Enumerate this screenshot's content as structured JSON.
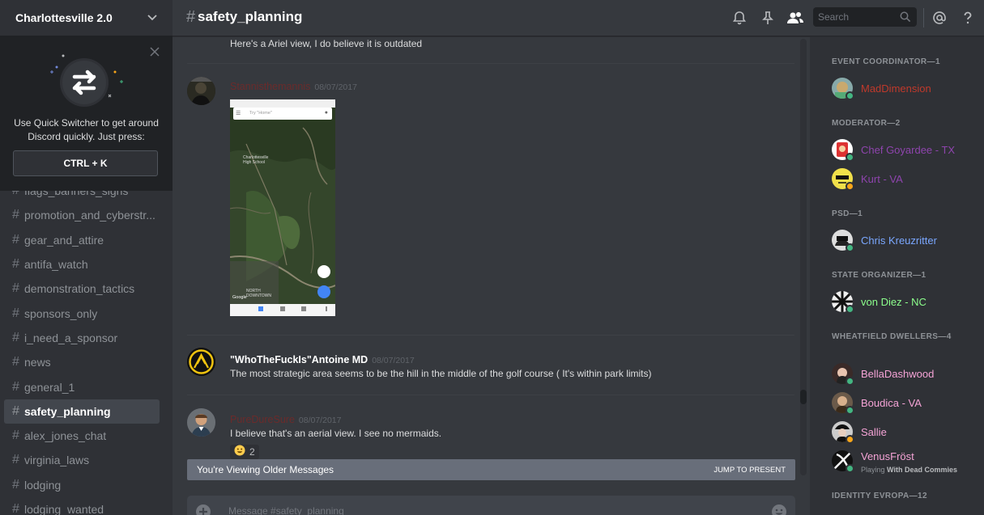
{
  "server": {
    "name": "Charlottesville 2.0"
  },
  "quick_switcher": {
    "text_line1": "Use Quick Switcher to get around",
    "text_line2": "Discord quickly. Just press:",
    "shortcut": "CTRL + K"
  },
  "channels": [
    {
      "name": "flags_banners_signs",
      "active": false
    },
    {
      "name": "promotion_and_cyberstr...",
      "active": false
    },
    {
      "name": "gear_and_attire",
      "active": false
    },
    {
      "name": "antifa_watch",
      "active": false
    },
    {
      "name": "demonstration_tactics",
      "active": false
    },
    {
      "name": "sponsors_only",
      "active": false
    },
    {
      "name": "i_need_a_sponsor",
      "active": false
    },
    {
      "name": "news",
      "active": false
    },
    {
      "name": "general_1",
      "active": false
    },
    {
      "name": "safety_planning",
      "active": true
    },
    {
      "name": "alex_jones_chat",
      "active": false
    },
    {
      "name": "virginia_laws",
      "active": false
    },
    {
      "name": "lodging",
      "active": false
    },
    {
      "name": "lodging_wanted",
      "active": false
    }
  ],
  "header": {
    "hash": "#",
    "channel": "safety_planning",
    "search_placeholder": "Search"
  },
  "messages": [
    {
      "author": "",
      "timestamp": "",
      "text": "Here's a Ariel view, I do believe it is outdated",
      "author_color": ""
    },
    {
      "author": "Stannisthemannis",
      "timestamp": "08/07/2017",
      "text": "",
      "author_color": "#6b2b2b",
      "attachment": {
        "search_placeholder": "Try \"Home\"",
        "map_label_1": "Charlottesville High School",
        "map_label_2": "NORTH DOWNTOWN",
        "google": "Google"
      }
    },
    {
      "author": "\"WhoTheFuckIs\"Antoine MD",
      "timestamp": "08/07/2017",
      "text": "The most strategic area seems to be the hill in the middle of the golf course ( It's within park limits)",
      "author_color": "#ffffff"
    },
    {
      "author": "PureDureSure",
      "timestamp": "08/07/2017",
      "text": "I believe that's an aerial view. I see no mermaids.",
      "author_color": "#6b2b2b",
      "reaction": {
        "emoji": "smile",
        "count": "2"
      }
    }
  ],
  "older_banner": {
    "label": "You're Viewing Older Messages",
    "jump": "JUMP TO PRESENT"
  },
  "composer": {
    "placeholder": "Message #safety_planning"
  },
  "member_groups": [
    {
      "role": "EVENT COORDINATOR—1",
      "members": [
        {
          "name": "MadDimension",
          "color": "#c0392b",
          "status": "online",
          "activity": ""
        }
      ]
    },
    {
      "role": "MODERATOR—2",
      "members": [
        {
          "name": "Chef Goyardee - TX",
          "color": "#8e44ad",
          "status": "online",
          "activity": ""
        },
        {
          "name": "Kurt - VA",
          "color": "#8e44ad",
          "status": "idle",
          "activity": ""
        }
      ]
    },
    {
      "role": "PSD—1",
      "members": [
        {
          "name": "Chris Kreuzritter",
          "color": "#7aa7ff",
          "status": "online",
          "activity": ""
        }
      ]
    },
    {
      "role": "STATE ORGANIZER—1",
      "members": [
        {
          "name": "von Diez - NC",
          "color": "#8cff8c",
          "status": "online",
          "activity": ""
        }
      ]
    },
    {
      "role": "WHEATFIELD DWELLERS—4",
      "members": [
        {
          "name": "BellaDashwood",
          "color": "#f5a3d6",
          "status": "online",
          "activity": ""
        },
        {
          "name": "Boudica - VA",
          "color": "#f5a3d6",
          "status": "online",
          "activity": ""
        },
        {
          "name": "Sallie",
          "color": "#f5a3d6",
          "status": "idle",
          "activity": ""
        },
        {
          "name": "VenusFröst",
          "color": "#f5a3d6",
          "status": "online",
          "activity_prefix": "Playing",
          "activity": "With Dead Commies"
        }
      ]
    },
    {
      "role": "IDENTITY EVROPA—12",
      "members": []
    }
  ],
  "colors": {
    "online": "#43b581",
    "idle": "#faa61a",
    "accent": "#7289da"
  }
}
